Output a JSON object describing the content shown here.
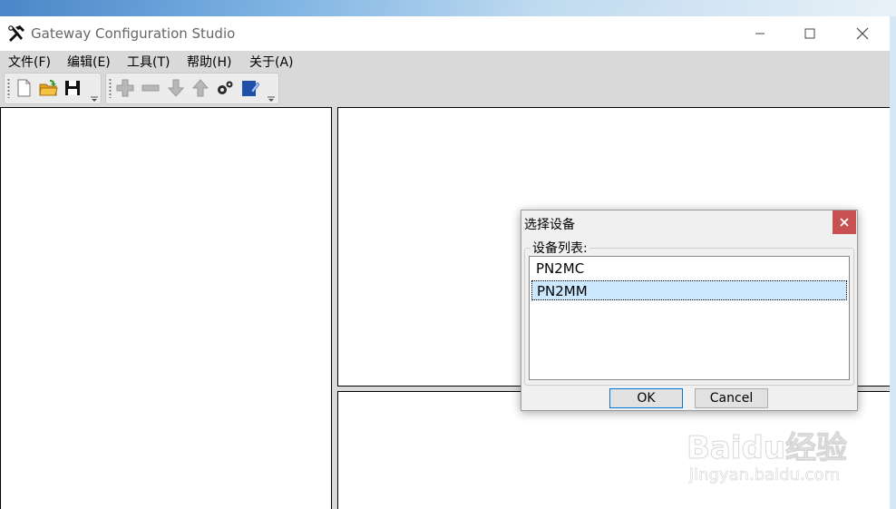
{
  "window": {
    "title": "Gateway Configuration Studio"
  },
  "menu": [
    {
      "label": "文件(F)"
    },
    {
      "label": "编辑(E)"
    },
    {
      "label": "工具(T)"
    },
    {
      "label": "帮助(H)"
    },
    {
      "label": "关于(A)"
    }
  ],
  "toolbar": {
    "group1": [
      "new-file-icon",
      "open-folder-icon",
      "save-icon"
    ],
    "group2": [
      "add-icon",
      "remove-icon",
      "move-down-icon",
      "move-up-icon",
      "settings-gears-icon",
      "edit-notebook-icon"
    ]
  },
  "dialog": {
    "title": "选择设备",
    "group_label": "设备列表:",
    "items": [
      {
        "label": "PN2MC",
        "selected": false
      },
      {
        "label": "PN2MM",
        "selected": true
      }
    ],
    "ok_label": "OK",
    "cancel_label": "Cancel",
    "close_glyph": "×"
  },
  "watermark": {
    "brand": "Baidu经验",
    "url": "jingyan.baidu.com"
  },
  "colors": {
    "menu_bg": "#d9d9d9",
    "dialog_close": "#c75050",
    "selection": "#cce8ff"
  }
}
